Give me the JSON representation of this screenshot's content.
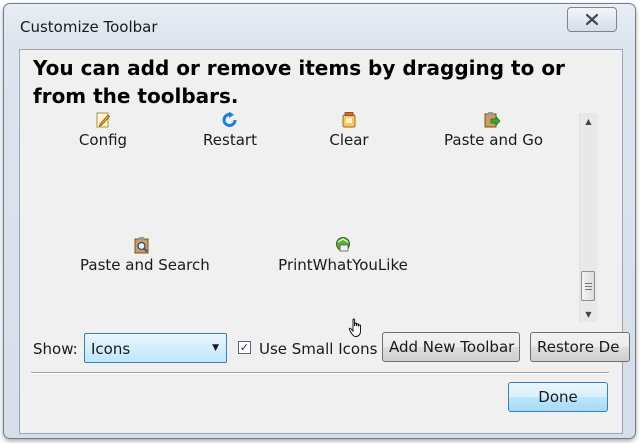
{
  "window": {
    "title": "Customize Toolbar"
  },
  "instructions": "You can add or remove items by dragging to or from the toolbars.",
  "palette": {
    "items": [
      {
        "label": "Config",
        "icon": "config-pencil-icon"
      },
      {
        "label": "Restart",
        "icon": "restart-arrow-icon"
      },
      {
        "label": "Clear",
        "icon": "clear-jar-icon"
      },
      {
        "label": "Paste and Go",
        "icon": "paste-and-go-icon"
      },
      {
        "label": "Paste and Search",
        "icon": "paste-and-search-icon"
      },
      {
        "label": "PrintWhatYouLike",
        "icon": "printwhatyoulike-icon"
      }
    ]
  },
  "controls": {
    "show_label": "Show:",
    "show_value": "Icons",
    "use_small_icons_label": "Use Small Icons",
    "use_small_icons_checked": true,
    "add_toolbar_label": "Add New Toolbar",
    "restore_label": "Restore De"
  },
  "footer": {
    "done_label": "Done"
  },
  "colors": {
    "dialog_background": "#f0f0f0",
    "select_accent": "#bee6fd",
    "button_border": "#707070"
  }
}
